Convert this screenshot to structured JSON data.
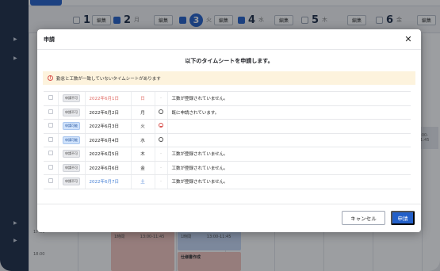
{
  "background": {
    "days": [
      {
        "num": "1",
        "weekday": "日",
        "checked": false
      },
      {
        "num": "2",
        "weekday": "月",
        "checked": true
      },
      {
        "num": "3",
        "weekday": "火",
        "checked": true,
        "today": true
      },
      {
        "num": "4",
        "weekday": "水",
        "checked": true
      },
      {
        "num": "5",
        "weekday": "木",
        "checked": false
      },
      {
        "num": "6",
        "weekday": "金",
        "checked": false
      }
    ],
    "edit_label": "編集",
    "times": [
      "17:00",
      "18:00"
    ],
    "events": [
      {
        "label": "1時間",
        "time": "13:00-11:45"
      },
      {
        "label": "1時間",
        "time": "13:00-11:45"
      },
      {
        "label": "仕様書作成",
        "time": ""
      }
    ],
    "side_time": "1:00-11:45"
  },
  "modal": {
    "title": "申請",
    "close_icon": "close-icon",
    "heading": "以下のタイムシートを申請します。",
    "alert_text": "勤怠と工数が一致していないタイムシートがあります",
    "rows": [
      {
        "badge": "申請不可",
        "badge_type": "no",
        "date": "2022年6月1日",
        "weekday": "日",
        "day_color": "sun",
        "status_icon": "dash",
        "message": "工数が登録されていません。"
      },
      {
        "badge": "申請不可",
        "badge_type": "no",
        "date": "2022年6月2日",
        "weekday": "月",
        "day_color": "",
        "status_icon": "smile",
        "message": "既に申請されています。"
      },
      {
        "badge": "申請可能",
        "badge_type": "ok",
        "date": "2022年6月3日",
        "weekday": "火",
        "day_color": "",
        "status_icon": "sad",
        "message": ""
      },
      {
        "badge": "申請可能",
        "badge_type": "ok",
        "date": "2022年6月4日",
        "weekday": "水",
        "day_color": "",
        "status_icon": "smile",
        "message": ""
      },
      {
        "badge": "申請不可",
        "badge_type": "no",
        "date": "2022年6月5日",
        "weekday": "木",
        "day_color": "",
        "status_icon": "dash",
        "message": "工数が登録されていません。"
      },
      {
        "badge": "申請不可",
        "badge_type": "no",
        "date": "2022年6月6日",
        "weekday": "金",
        "day_color": "",
        "status_icon": "dash",
        "message": "工数が登録されていません。"
      },
      {
        "badge": "申請不可",
        "badge_type": "no",
        "date": "2022年6月7日",
        "weekday": "土",
        "day_color": "sat",
        "status_icon": "dash",
        "message": "工数が登録されていません。"
      }
    ],
    "cancel_label": "キャンセル",
    "submit_label": "申請"
  },
  "colors": {
    "primary": "#2360c9",
    "sidebar": "#1d2b45",
    "alert_bg": "#fdf3dd",
    "sunday": "#e06a63",
    "saturday": "#4a83d6"
  }
}
